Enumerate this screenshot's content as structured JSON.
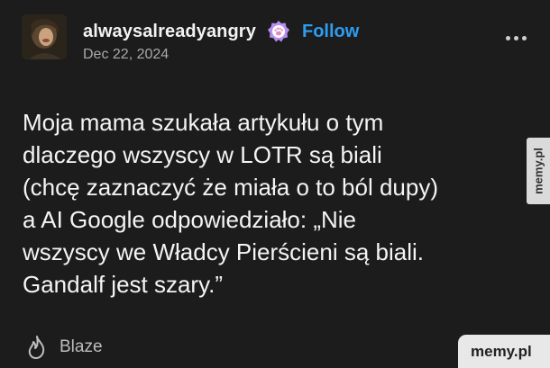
{
  "post": {
    "username": "alwaysalreadyangry",
    "follow_label": "Follow",
    "date": "Dec 22, 2024",
    "body_lines": [
      "Moja mama szukała artykułu o tym",
      "dlaczego wszyscy w LOTR są biali",
      "(chcę zaznaczyć że miała o to ból dupy)",
      "a AI Google odpowiedziało: „Nie",
      "wszyscy we Władcy Pierścieni są biali.",
      "Gandalf jest szary.”"
    ],
    "footer": {
      "blaze_label": "Blaze"
    }
  },
  "watermarks": {
    "side": "memy.pl",
    "corner": "memy.pl"
  },
  "icons": {
    "badge": "paw-badge-icon",
    "more": "more-dots-icon",
    "blaze": "flame-icon"
  },
  "colors": {
    "background": "#1c1c1c",
    "follow": "#2f9cf0",
    "badge": "#b78df0"
  }
}
